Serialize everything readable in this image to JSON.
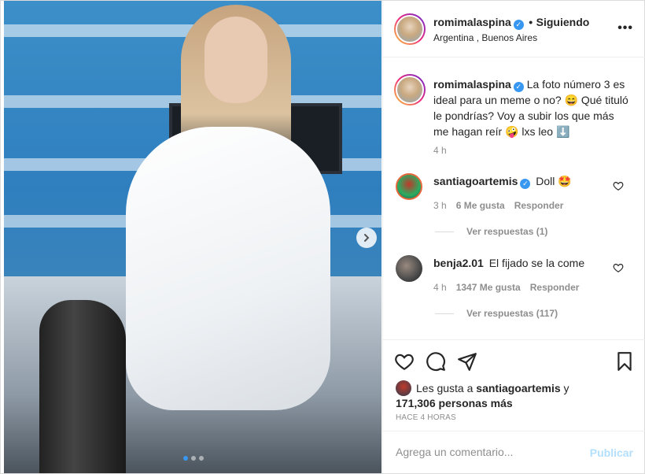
{
  "post": {
    "carousel": {
      "active_index": 0,
      "total": 3
    }
  },
  "header": {
    "username": "romimalaspina",
    "separator": "•",
    "follow_label": "Siguiendo",
    "location": "Argentina , Buenos Aires"
  },
  "caption": {
    "username": "romimalaspina",
    "text": "La foto número 3 es ideal para un meme o no? 😄 Qué tituló le pondrías? Voy a subir los que más me hagan reír 🤪 lxs leo ⬇️",
    "time": "4 h"
  },
  "comments": [
    {
      "username": "santiagoartemis",
      "verified": true,
      "text": "Doll 🤩",
      "time": "3 h",
      "likes": "6 Me gusta",
      "reply_label": "Responder",
      "view_replies": "Ver respuestas (1)"
    },
    {
      "username": "benja2.01",
      "verified": false,
      "text": "El fijado se la come",
      "time": "4 h",
      "likes": "1347 Me gusta",
      "reply_label": "Responder",
      "view_replies": "Ver respuestas (117)"
    }
  ],
  "likes": {
    "prefix": "Les gusta a",
    "user": "santiagoartemis",
    "conjunction": "y",
    "others": "171,306 personas más"
  },
  "posted_time": "HACE 4 HORAS",
  "add_comment": {
    "placeholder": "Agrega un comentario...",
    "publish_label": "Publicar"
  },
  "icons": {
    "header_more": "more-horizontal-icon",
    "carousel_next": "chevron-right-icon",
    "like": "heart-icon",
    "comment": "comment-bubble-icon",
    "share": "paper-plane-icon",
    "save": "bookmark-icon",
    "verified": "verified-badge-icon"
  },
  "colors": {
    "accent_blue": "#3897f0",
    "publish_disabled": "#b2dffc",
    "muted_text": "#8e8e8e"
  }
}
